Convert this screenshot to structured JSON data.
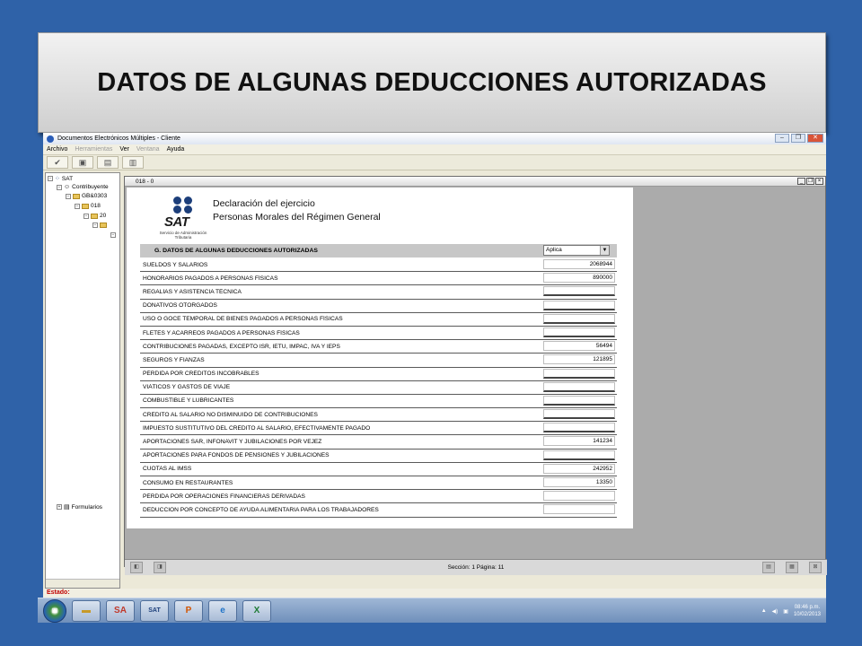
{
  "banner": {
    "title": "DATOS DE ALGUNAS DEDUCCIONES AUTORIZADAS"
  },
  "app": {
    "title": "Documentos Electrónicos Múltiples - Cliente",
    "menu": [
      "Archivo",
      "Herramientas",
      "Ver",
      "Ventana",
      "Ayuda"
    ],
    "toolbar_icons": [
      "check-icon",
      "lock-icon",
      "document-icon",
      "print-icon"
    ]
  },
  "tree": {
    "root": "SAT",
    "contribuyente": "Contribuyente",
    "rfc": "GB&0303",
    "folder_018": "018",
    "folder_20": "20",
    "formularios": "Formularios"
  },
  "doc": {
    "window_title": "018 - 0",
    "sat_brand": "SAT",
    "sat_sub": "Servicio de Administración Tributaria",
    "decl_title": "Declaración del ejercicio",
    "decl_sub": "Personas Morales del Régimen General",
    "section_title": "G. DATOS DE ALGUNAS DEDUCCIONES AUTORIZADAS",
    "aplica": "Aplica",
    "rows": [
      {
        "label": "SUELDOS Y SALARIOS",
        "value": "2068944"
      },
      {
        "label": "HONORARIOS PAGADOS A PERSONAS FÍSICAS",
        "value": "890000"
      },
      {
        "label": "REGALÍAS Y ASISTENCIA TÉCNICA",
        "value": ""
      },
      {
        "label": "DONATIVOS OTORGADOS",
        "value": ""
      },
      {
        "label": "USO O GOCE TEMPORAL DE BIENES PAGADOS A PERSONAS FÍSICAS",
        "value": ""
      },
      {
        "label": "FLETES Y ACARREOS PAGADOS A PERSONAS FÍSICAS",
        "value": ""
      },
      {
        "label": "CONTRIBUCIONES PAGADAS, EXCEPTO ISR, IETU, IMPAC, IVA Y IEPS",
        "value": "56494"
      },
      {
        "label": "SEGUROS Y FIANZAS",
        "value": "121895"
      },
      {
        "label": "PÉRDIDA POR CRÉDITOS INCOBRABLES",
        "value": ""
      },
      {
        "label": "VIÁTICOS Y GASTOS DE VIAJE",
        "value": ""
      },
      {
        "label": "COMBUSTIBLE Y LUBRICANTES",
        "value": ""
      },
      {
        "label": "CRÉDITO AL SALARIO NO DISMINUIDO DE CONTRIBUCIONES",
        "value": ""
      },
      {
        "label": "IMPUESTO SUSTITUTIVO DEL CRÉDITO AL SALARIO, EFECTIVAMENTE PAGADO",
        "value": ""
      },
      {
        "label": "APORTACIONES SAR, INFONAVIT Y JUBILACIONES POR VEJEZ",
        "value": "141234"
      },
      {
        "label": "APORTACIONES PARA FONDOS DE PENSIONES Y JUBILACIONES",
        "value": ""
      },
      {
        "label": "CUOTAS AL IMSS",
        "value": "242952"
      },
      {
        "label": "CONSUMO EN RESTAURANTES",
        "value": "13350"
      },
      {
        "label": "PÉRDIDA POR OPERACIONES FINANCIERAS DERIVADAS",
        "value": ""
      },
      {
        "label": "DEDUCCIÓN POR CONCEPTO DE AYUDA ALIMENTARIA PARA LOS TRABAJADORES",
        "value": ""
      }
    ],
    "status": "Sección: 1  Página: 11"
  },
  "estado": "Estado:",
  "taskbar": {
    "time": "08:46 p.m.",
    "date": "10/02/2013",
    "sa_label": "SA",
    "sat_label": "SAT"
  }
}
